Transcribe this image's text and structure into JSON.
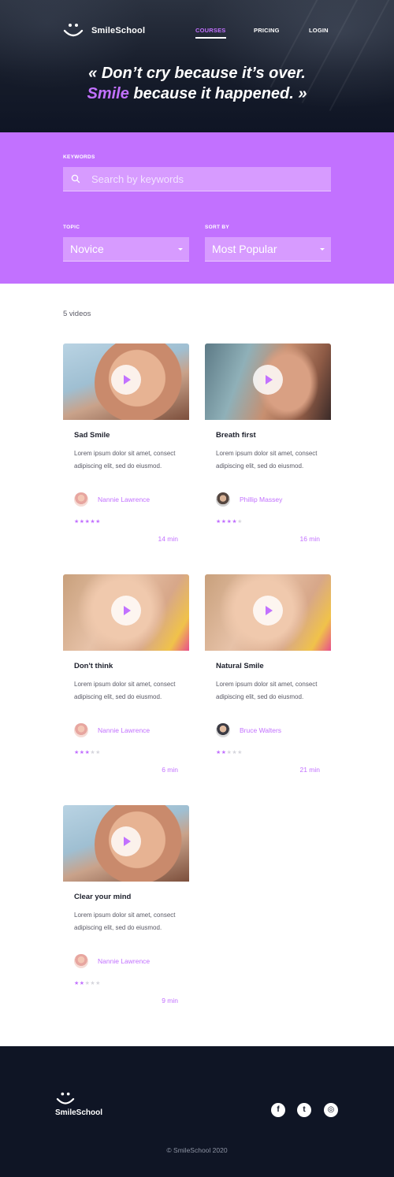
{
  "header": {
    "brand": "SmileSchool",
    "nav": [
      {
        "label": "COURSES",
        "active": true
      },
      {
        "label": "PRICING",
        "active": false
      },
      {
        "label": "LOGIN",
        "active": false
      }
    ],
    "quote_line1": "« Don’t cry because it’s over.",
    "quote_highlight": "Smile",
    "quote_line2_rest": " because it happened. »"
  },
  "filters": {
    "keywords_label": "KEYWORDS",
    "search_placeholder": "Search by keywords",
    "topic_label": "TOPIC",
    "topic_value": "Novice",
    "sort_label": "SORT BY",
    "sort_value": "Most Popular"
  },
  "results": {
    "count": "5 videos",
    "videos": [
      {
        "title": "Sad Smile",
        "description": "Lorem ipsum dolor sit amet, consect adipiscing elit, sed do eiusmod.",
        "author": "Nannie Lawrence",
        "stars": 5,
        "duration": "14 min"
      },
      {
        "title": "Breath first",
        "description": "Lorem ipsum dolor sit amet, consect adipiscing elit, sed do eiusmod.",
        "author": "Phillip Massey",
        "stars": 4,
        "duration": "16 min"
      },
      {
        "title": "Don't think",
        "description": "Lorem ipsum dolor sit amet, consect adipiscing elit, sed do eiusmod.",
        "author": "Nannie Lawrence",
        "stars": 3,
        "duration": "6 min"
      },
      {
        "title": "Natural Smile",
        "description": "Lorem ipsum dolor sit amet, consect adipiscing elit, sed do eiusmod.",
        "author": "Bruce Walters",
        "stars": 2,
        "duration": "21 min"
      },
      {
        "title": "Clear your mind",
        "description": "Lorem ipsum dolor sit amet, consect adipiscing elit, sed do eiusmod.",
        "author": "Nannie Lawrence",
        "stars": 2,
        "duration": "9 min"
      }
    ]
  },
  "footer": {
    "brand": "SmileSchool",
    "social": [
      {
        "icon": "facebook-icon",
        "glyph": "f"
      },
      {
        "icon": "twitter-icon",
        "glyph": "t"
      },
      {
        "icon": "instagram-icon",
        "glyph": "◎"
      }
    ],
    "copyright": "© SmileSchool 2020"
  },
  "colors": {
    "accent": "#c271ff",
    "dark": "#0f1525"
  }
}
